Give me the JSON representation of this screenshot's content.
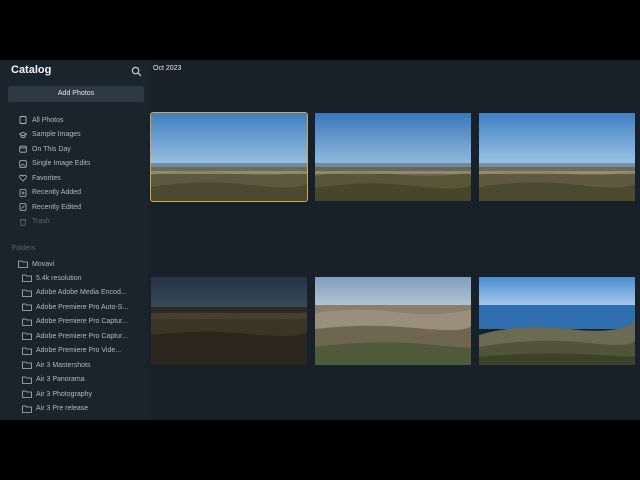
{
  "sidebar": {
    "title": "Catalog",
    "add_photos_label": "Add Photos",
    "nav_items": [
      {
        "label": "All Photos",
        "icon": "photos-icon"
      },
      {
        "label": "Sample Images",
        "icon": "graduation-cap-icon"
      },
      {
        "label": "On This Day",
        "icon": "calendar-icon"
      },
      {
        "label": "Single Image Edits",
        "icon": "image-edit-icon"
      },
      {
        "label": "Favorites",
        "icon": "heart-icon"
      },
      {
        "label": "Recently Added",
        "icon": "recent-add-icon"
      },
      {
        "label": "Recently Edited",
        "icon": "recent-edit-icon"
      },
      {
        "label": "Trash",
        "icon": "trash-icon"
      }
    ],
    "folders_label": "Folders",
    "root_folder": "Movavi",
    "folders": [
      "5.4k resolution",
      "Adobe Adobe Media Encod...",
      "Adobe Premiere Pro Auto-S...",
      "Adobe Premiere Pro Captur...",
      "Adobe Premiere Pro Captur...",
      "Adobe Premiere Pro Vide...",
      "Air 3 Mastershots",
      "Air 3 Panorama",
      "Air 3 Photography",
      "Air 3 Pre release"
    ]
  },
  "main": {
    "date_header": "Oct 2023",
    "photos": [
      {
        "name": "photo-1",
        "selected": true
      },
      {
        "name": "photo-2",
        "selected": false
      },
      {
        "name": "photo-3",
        "selected": false
      },
      {
        "name": "photo-4",
        "selected": false
      },
      {
        "name": "photo-5",
        "selected": false
      },
      {
        "name": "photo-6",
        "selected": false
      }
    ]
  },
  "colors": {
    "sidebar_bg": "#1a242d",
    "main_bg": "#18212a",
    "selection": "#d4a84a",
    "button_bg": "#2d3a46"
  }
}
